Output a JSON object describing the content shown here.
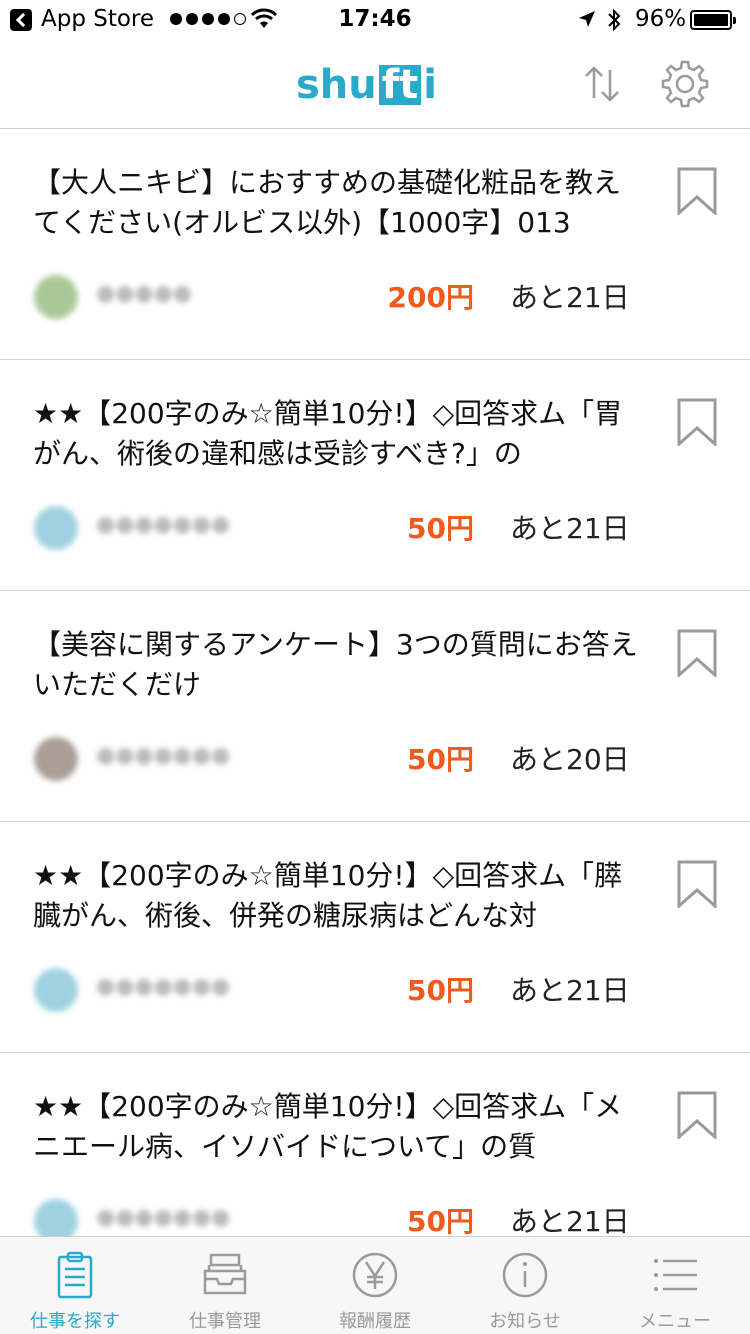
{
  "status_bar": {
    "back_app": "App Store",
    "time": "17:46",
    "battery": "96%"
  },
  "nav": {
    "logo_pre": "shu",
    "logo_boxed": "ft",
    "logo_post": "i"
  },
  "items": [
    {
      "title": "【大人ニキビ】におすすめの基礎化粧品を教えてください(オルビス以外)【1000字】013",
      "price": "200円",
      "remaining": "あと21日",
      "avatar_color": "#9bbf86"
    },
    {
      "title": "★★【200字のみ☆簡単10分!】◇回答求ム「胃がん、術後の違和感は受診すべき?」の",
      "price": "50円",
      "remaining": "あと21日",
      "avatar_color": "#8fc9dd"
    },
    {
      "title": "【美容に関するアンケート】3つの質問にお答えいただくだけ",
      "price": "50円",
      "remaining": "あと20日",
      "avatar_color": "#9c8f86"
    },
    {
      "title": "★★【200字のみ☆簡単10分!】◇回答求ム「膵臓がん、術後、併発の糖尿病はどんな対",
      "price": "50円",
      "remaining": "あと21日",
      "avatar_color": "#8fc9dd"
    },
    {
      "title": "★★【200字のみ☆簡単10分!】◇回答求ム「メニエール病、イソバイドについて」の質",
      "price": "50円",
      "remaining": "あと21日",
      "avatar_color": "#8fc9dd"
    }
  ],
  "tabs": [
    {
      "label": "仕事を探す",
      "icon": "clipboard-icon",
      "active": true
    },
    {
      "label": "仕事管理",
      "icon": "inbox-tray-icon",
      "active": false
    },
    {
      "label": "報酬履歴",
      "icon": "yen-icon",
      "active": false
    },
    {
      "label": "お知らせ",
      "icon": "info-icon",
      "active": false
    },
    {
      "label": "メニュー",
      "icon": "menu-list-icon",
      "active": false
    }
  ],
  "colors": {
    "brand": "#2aa9c9",
    "price": "#f25a1d",
    "inactive_icon": "#9a9a9a"
  }
}
